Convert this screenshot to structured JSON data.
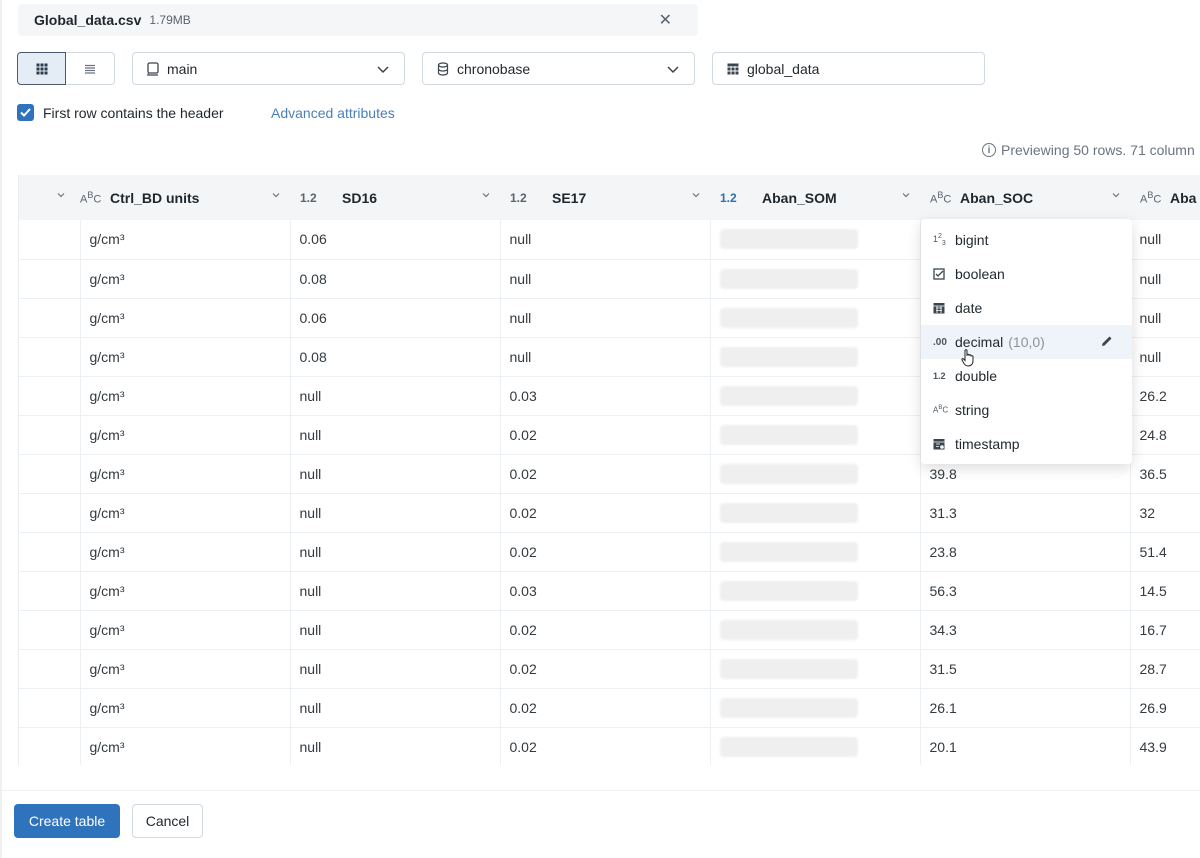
{
  "file": {
    "name": "Global_data.csv",
    "size": "1.79MB"
  },
  "selectors": {
    "catalog": "main",
    "schema": "chronobase",
    "table": "global_data"
  },
  "options": {
    "header_checkbox_label": "First row contains the header",
    "header_checked": true,
    "advanced_link": "Advanced attributes"
  },
  "preview_note": "Previewing 50 rows. 71 column",
  "columns": [
    {
      "name": "",
      "type": "string"
    },
    {
      "name": "Ctrl_BD units",
      "type": "string",
      "type_label": "ABC"
    },
    {
      "name": "SD16",
      "type": "double",
      "type_label": "1.2"
    },
    {
      "name": "SE17",
      "type": "double",
      "type_label": "1.2"
    },
    {
      "name": "Aban_SOM",
      "type": "double",
      "type_label": "1.2"
    },
    {
      "name": "Aban_SOC",
      "type": "string",
      "type_label": "ABC"
    },
    {
      "name": "Aba",
      "type": "string",
      "type_label": "ABC"
    }
  ],
  "rows": [
    [
      "g/cm³",
      "0.06",
      "null",
      "",
      "",
      "null"
    ],
    [
      "g/cm³",
      "0.08",
      "null",
      "",
      "",
      "null"
    ],
    [
      "g/cm³",
      "0.06",
      "null",
      "",
      "",
      "null"
    ],
    [
      "g/cm³",
      "0.08",
      "null",
      "",
      "",
      "null"
    ],
    [
      "g/cm³",
      "null",
      "0.03",
      "",
      "",
      "26.2"
    ],
    [
      "g/cm³",
      "null",
      "0.02",
      "",
      "",
      "24.8"
    ],
    [
      "g/cm³",
      "null",
      "0.02",
      "",
      "39.8",
      "36.5"
    ],
    [
      "g/cm³",
      "null",
      "0.02",
      "",
      "31.3",
      "32"
    ],
    [
      "g/cm³",
      "null",
      "0.02",
      "",
      "23.8",
      "51.4"
    ],
    [
      "g/cm³",
      "null",
      "0.03",
      "",
      "56.3",
      "14.5"
    ],
    [
      "g/cm³",
      "null",
      "0.02",
      "",
      "34.3",
      "16.7"
    ],
    [
      "g/cm³",
      "null",
      "0.02",
      "",
      "31.5",
      "28.7"
    ],
    [
      "g/cm³",
      "null",
      "0.02",
      "",
      "26.1",
      "26.9"
    ],
    [
      "g/cm³",
      "null",
      "0.02",
      "",
      "20.1",
      "43.9"
    ]
  ],
  "type_menu": {
    "items": [
      {
        "label": "bigint",
        "icon": "123",
        "param": ""
      },
      {
        "label": "boolean",
        "icon": "checkbox",
        "param": ""
      },
      {
        "label": "date",
        "icon": "calendar",
        "param": ""
      },
      {
        "label": "decimal",
        "icon": ".00",
        "param": "(10,0)",
        "hovered": true
      },
      {
        "label": "double",
        "icon": "1.2",
        "param": ""
      },
      {
        "label": "string",
        "icon": "ABC",
        "param": ""
      },
      {
        "label": "timestamp",
        "icon": "calendar-clock",
        "param": ""
      }
    ]
  },
  "footer": {
    "create_label": "Create table",
    "cancel_label": "Cancel"
  },
  "colors": {
    "accent": "#2f73bd",
    "link": "#4a7fb8",
    "header_bg": "#f3f5f7"
  }
}
